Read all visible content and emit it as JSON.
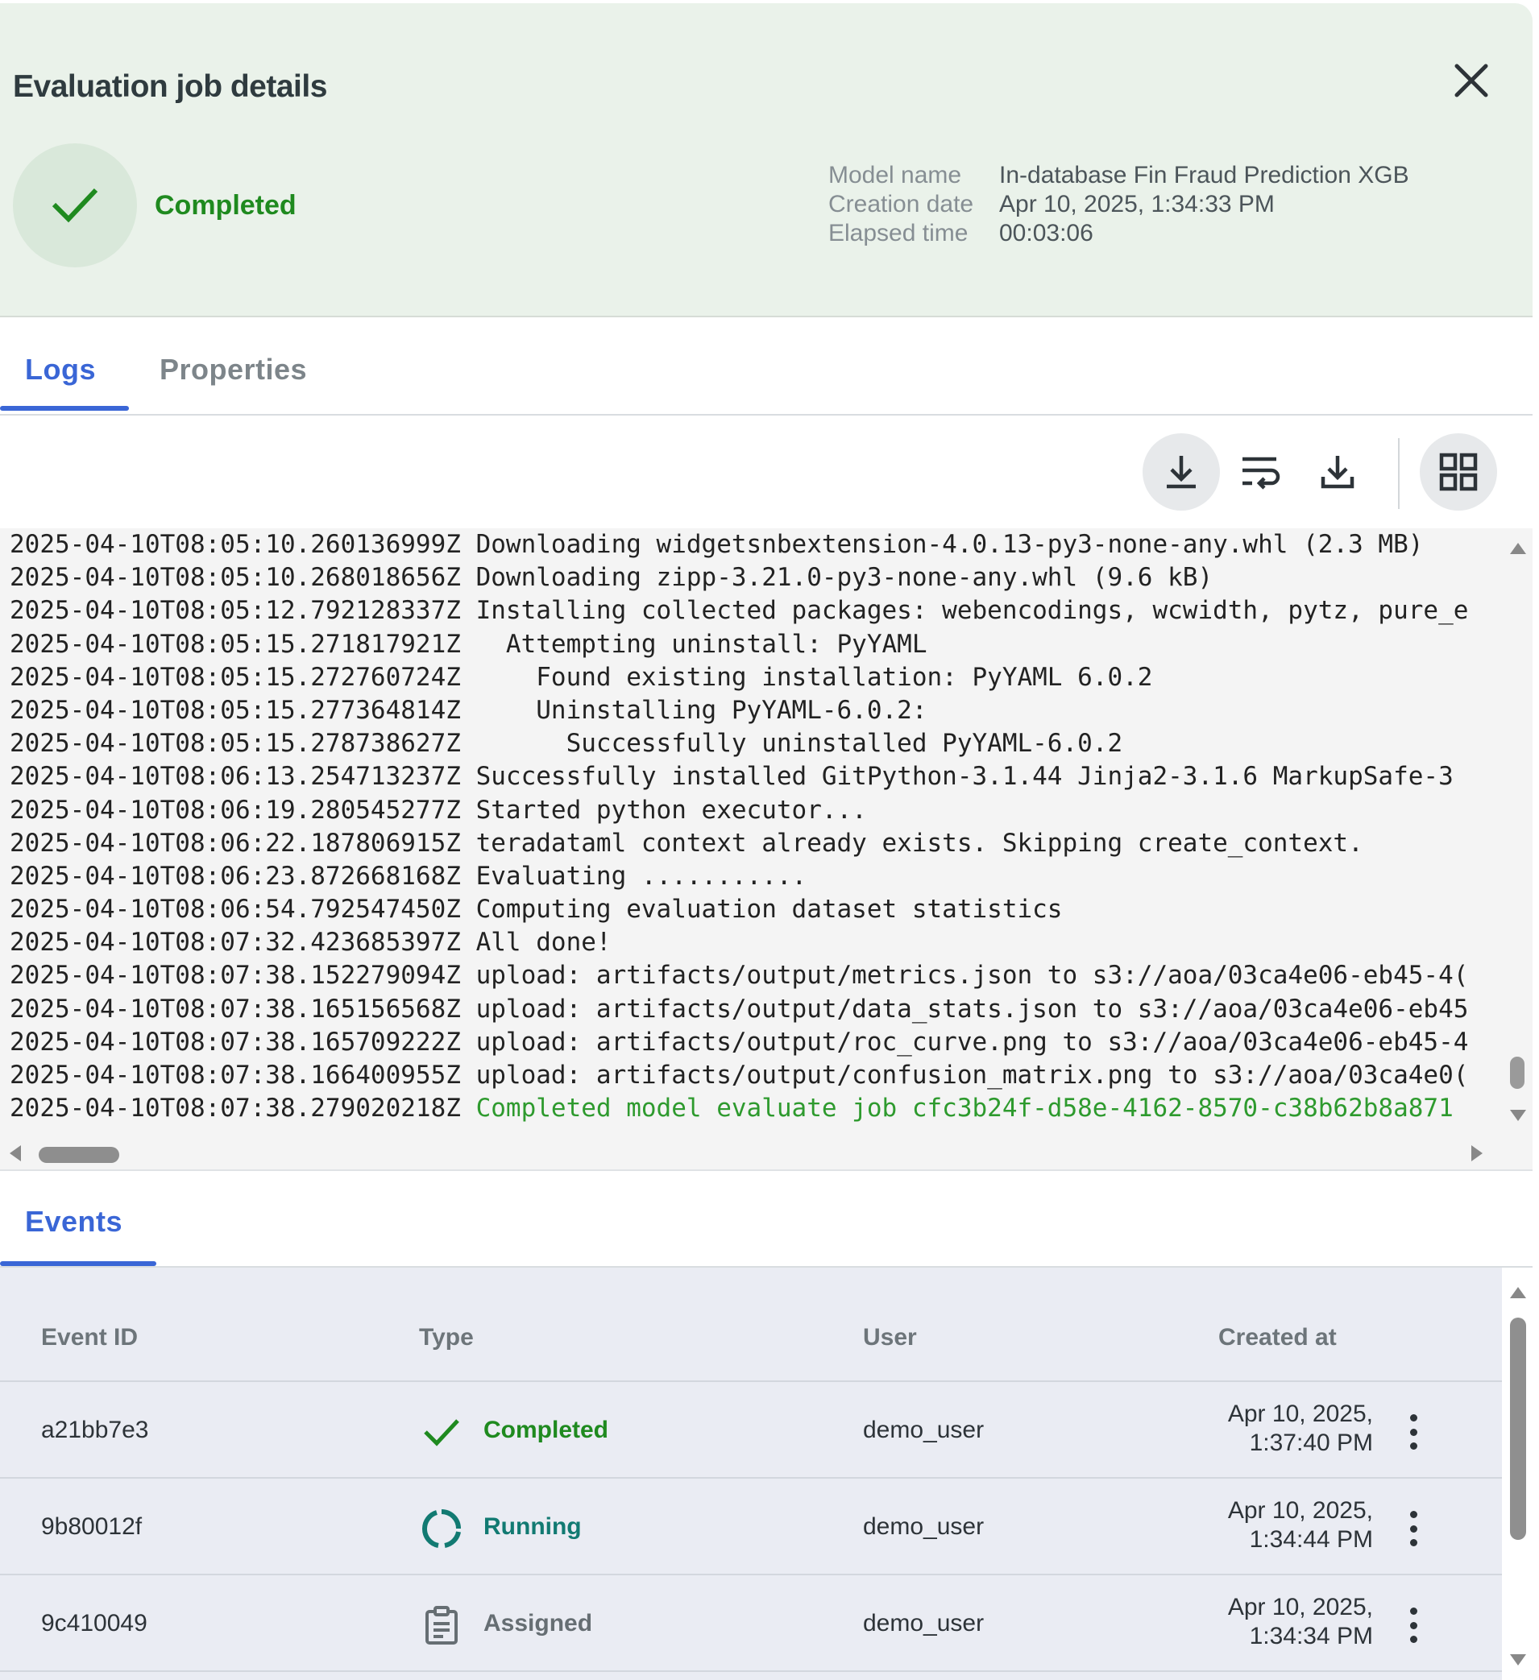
{
  "header": {
    "title": "Evaluation job details",
    "status": "Completed",
    "meta": [
      {
        "key": "Model name",
        "value": "In-database Fin Fraud Prediction XGB"
      },
      {
        "key": "Creation date",
        "value": "Apr 10, 2025, 1:34:33 PM"
      },
      {
        "key": "Elapsed time",
        "value": "00:03:06"
      }
    ]
  },
  "tabs": {
    "logs": "Logs",
    "properties": "Properties"
  },
  "toolbar": {
    "icons": [
      "download-icon",
      "wrap-text-icon",
      "download-icon",
      "grid-view-icon"
    ]
  },
  "logs": [
    {
      "ts": "2025-04-10T08:05:10.260136999Z",
      "msg": "Downloading widgetsnbextension-4.0.13-py3-none-any.whl (2.3 MB)"
    },
    {
      "ts": "2025-04-10T08:05:10.268018656Z",
      "msg": "Downloading zipp-3.21.0-py3-none-any.whl (9.6 kB)"
    },
    {
      "ts": "2025-04-10T08:05:12.792128337Z",
      "msg": "Installing collected packages: webencodings, wcwidth, pytz, pure_e"
    },
    {
      "ts": "2025-04-10T08:05:15.271817921Z",
      "msg": "  Attempting uninstall: PyYAML"
    },
    {
      "ts": "2025-04-10T08:05:15.272760724Z",
      "msg": "    Found existing installation: PyYAML 6.0.2"
    },
    {
      "ts": "2025-04-10T08:05:15.277364814Z",
      "msg": "    Uninstalling PyYAML-6.0.2:"
    },
    {
      "ts": "2025-04-10T08:05:15.278738627Z",
      "msg": "      Successfully uninstalled PyYAML-6.0.2"
    },
    {
      "ts": "2025-04-10T08:06:13.254713237Z",
      "msg": "Successfully installed GitPython-3.1.44 Jinja2-3.1.6 MarkupSafe-3"
    },
    {
      "ts": "2025-04-10T08:06:19.280545277Z",
      "msg": "Started python executor..."
    },
    {
      "ts": "2025-04-10T08:06:22.187806915Z",
      "msg": "teradataml context already exists. Skipping create_context."
    },
    {
      "ts": "2025-04-10T08:06:23.872668168Z",
      "msg": "Evaluating ..........."
    },
    {
      "ts": "2025-04-10T08:06:54.792547450Z",
      "msg": "Computing evaluation dataset statistics"
    },
    {
      "ts": "2025-04-10T08:07:32.423685397Z",
      "msg": "All done!"
    },
    {
      "ts": "2025-04-10T08:07:38.152279094Z",
      "msg": "upload: artifacts/output/metrics.json to s3://aoa/03ca4e06-eb45-4("
    },
    {
      "ts": "2025-04-10T08:07:38.165156568Z",
      "msg": "upload: artifacts/output/data_stats.json to s3://aoa/03ca4e06-eb45"
    },
    {
      "ts": "2025-04-10T08:07:38.165709222Z",
      "msg": "upload: artifacts/output/roc_curve.png to s3://aoa/03ca4e06-eb45-4"
    },
    {
      "ts": "2025-04-10T08:07:38.166400955Z",
      "msg": "upload: artifacts/output/confusion_matrix.png to s3://aoa/03ca4e0("
    },
    {
      "ts": "2025-04-10T08:07:38.279020218Z",
      "msg": "Completed model evaluate job cfc3b24f-d58e-4162-8570-c38b62b8a871"
    }
  ],
  "events": {
    "tab": "Events",
    "columns": {
      "id": "Event ID",
      "type": "Type",
      "user": "User",
      "created": "Created at"
    },
    "rows": [
      {
        "id": "a21bb7e3",
        "type": "Completed",
        "icon": "check-icon",
        "user": "demo_user",
        "date": "Apr 10, 2025,",
        "time": "1:37:40 PM"
      },
      {
        "id": "9b80012f",
        "type": "Running",
        "icon": "running-icon",
        "user": "demo_user",
        "date": "Apr 10, 2025,",
        "time": "1:34:44 PM"
      },
      {
        "id": "9c410049",
        "type": "Assigned",
        "icon": "clipboard-icon",
        "user": "demo_user",
        "date": "Apr 10, 2025,",
        "time": "1:34:34 PM"
      }
    ]
  },
  "colors": {
    "accent": "#3a66d6",
    "success": "#1f8a1f",
    "running": "#127a72",
    "header_bg": "#eaf2ea"
  }
}
